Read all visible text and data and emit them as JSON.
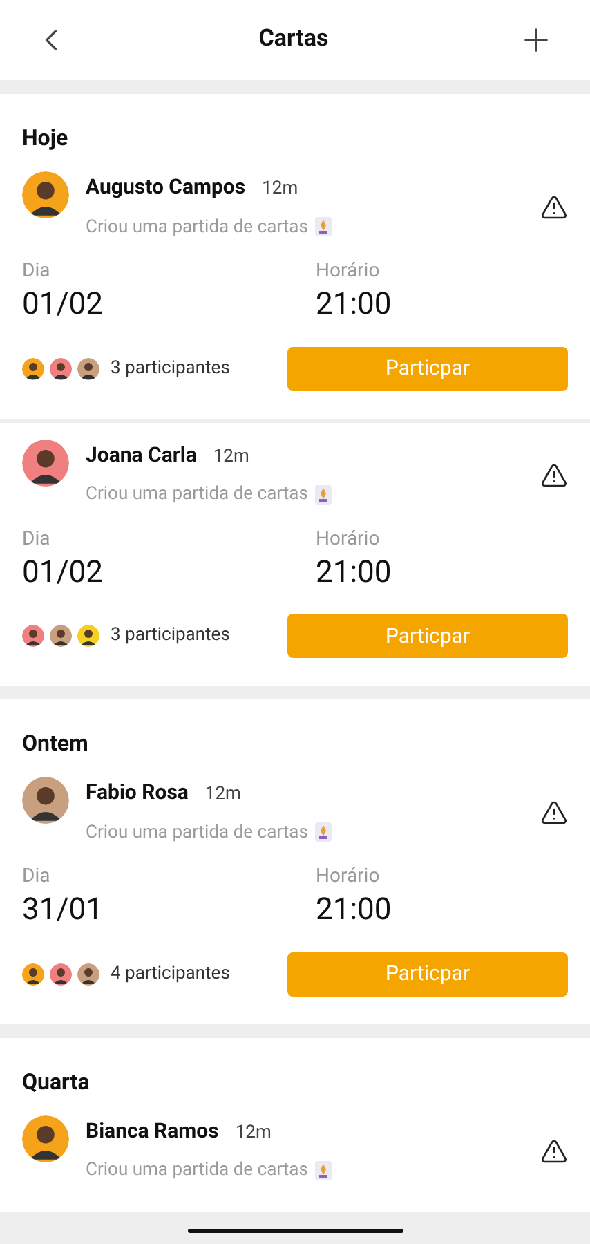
{
  "header": {
    "title": "Cartas"
  },
  "sections": [
    {
      "title": "Hoje",
      "posts": [
        {
          "name": "Augusto Campos",
          "time": "12m",
          "description": "Criou uma partida de cartas",
          "day_label": "Dia",
          "day": "01/02",
          "hour_label": "Horário",
          "hour": "21:00",
          "participants": "3 participantes",
          "button": "Particpar"
        },
        {
          "name": "Joana Carla",
          "time": "12m",
          "description": "Criou uma partida de cartas",
          "day_label": "Dia",
          "day": "01/02",
          "hour_label": "Horário",
          "hour": "21:00",
          "participants": "3 participantes",
          "button": "Particpar"
        }
      ]
    },
    {
      "title": "Ontem",
      "posts": [
        {
          "name": "Fabio Rosa",
          "time": "12m",
          "description": "Criou uma partida de cartas",
          "day_label": "Dia",
          "day": "31/01",
          "hour_label": "Horário",
          "hour": "21:00",
          "participants": "4 participantes",
          "button": "Particpar"
        }
      ]
    },
    {
      "title": "Quarta",
      "posts": [
        {
          "name": "Bianca Ramos",
          "time": "12m",
          "description": "Criou uma partida de cartas"
        }
      ]
    }
  ]
}
